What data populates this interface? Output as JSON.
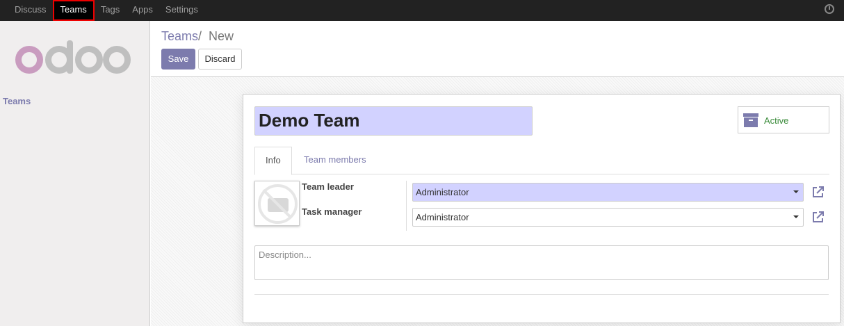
{
  "topbar": {
    "menu": [
      "Discuss",
      "Teams",
      "Tags",
      "Apps",
      "Settings"
    ],
    "active_item": "Teams"
  },
  "sidebar": {
    "logo_alt": "odoo",
    "nav_item": "Teams"
  },
  "breadcrumb": {
    "parent": "Teams",
    "separator": "/",
    "current": "New"
  },
  "actions": {
    "save_label": "Save",
    "discard_label": "Discard"
  },
  "form": {
    "name": "Demo Team",
    "active_label": "Active",
    "tabs": [
      "Info",
      "Team members"
    ],
    "active_tab": "Info",
    "team_leader_label": "Team leader",
    "team_leader_value": "Administrator",
    "task_manager_label": "Task manager",
    "task_manager_value": "Administrator",
    "description_placeholder": "Description..."
  },
  "colors": {
    "accent": "#7c7bad",
    "active_green": "#3c8c3c",
    "highlight_field": "#d2d2ff"
  }
}
